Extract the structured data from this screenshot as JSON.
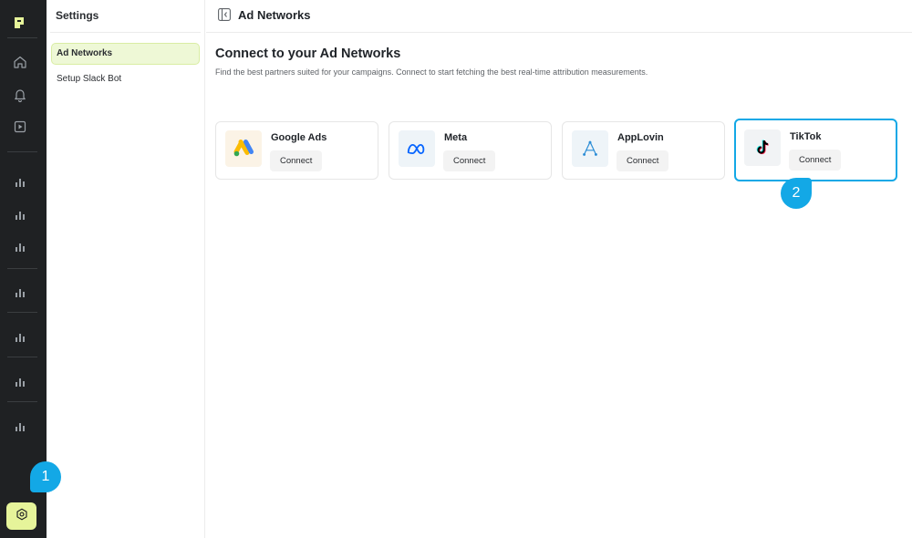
{
  "rail": {
    "icons": [
      "logo-icon",
      "home-icon",
      "bell-icon",
      "play-icon",
      "bar-chart-icon",
      "bar-chart-icon",
      "bar-chart-icon",
      "bar-chart-icon",
      "bar-chart-icon",
      "bar-chart-icon",
      "bar-chart-icon",
      "settings-icon"
    ],
    "accent": "#e6f49a"
  },
  "sidebar": {
    "title": "Settings",
    "items": [
      {
        "label": "Ad Networks",
        "active": true
      },
      {
        "label": "Setup Slack Bot",
        "active": false
      }
    ]
  },
  "header": {
    "title": "Ad Networks"
  },
  "main": {
    "heading": "Connect to your Ad Networks",
    "subheading": "Find the best partners suited for your campaigns. Connect to start fetching the best real-time attribution measurements.",
    "networks": [
      {
        "name": "Google Ads",
        "button": "Connect",
        "icon": "google-ads-icon"
      },
      {
        "name": "Meta",
        "button": "Connect",
        "icon": "meta-icon"
      },
      {
        "name": "AppLovin",
        "button": "Connect",
        "icon": "applovin-icon"
      },
      {
        "name": "TikTok",
        "button": "Connect",
        "icon": "tiktok-icon",
        "selected": true
      }
    ]
  },
  "markers": {
    "step1": "1",
    "step2": "2",
    "color": "#13a8e6"
  }
}
